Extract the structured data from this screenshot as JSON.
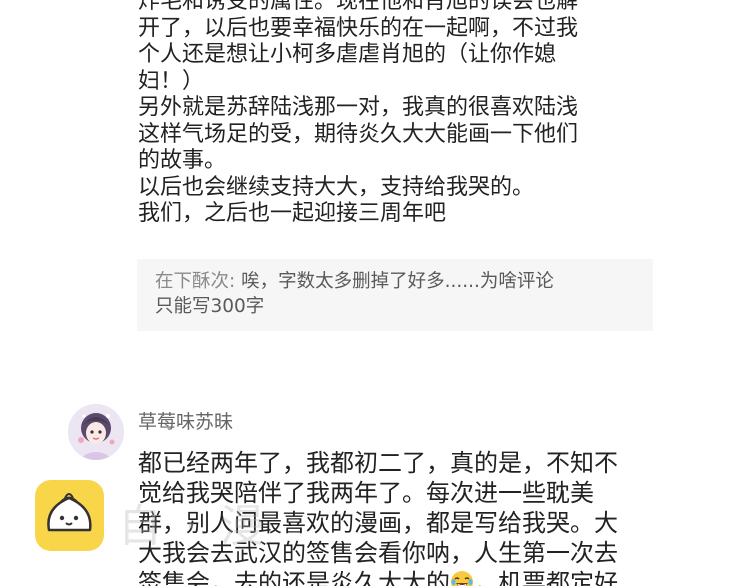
{
  "first_comment": {
    "lines": [
      "炸毛和诱受的属性。现在他和肖旭的误会也解",
      "开了，以后也要幸福快乐的在一起啊，不过我",
      "个人还是想让小柯多虐虐肖旭的（让你作媳",
      "妇！）",
      "另外就是苏辞陆浅那一对，我真的很喜欢陆浅",
      "这样气场足的受，期待炎久大大能画一下他们",
      "的故事。",
      "以后也会继续支持大大，支持给我哭的。",
      "我们，之后也一起迎接三周年吧"
    ]
  },
  "reply": {
    "author": "在下酥次:",
    "line1": " 唉，字数太多删掉了好多......为啥评论",
    "line2": "只能写300字"
  },
  "second_comment": {
    "username": "草莓味苏昧",
    "lines": [
      "都已经两年了，我都初二了，真的是，不知不",
      "觉给我哭陪伴了我两年了。每次进一些耽美",
      "群，别人问最喜欢的漫画，都是写给我哭。大",
      "大我会去武汉的签售会看你呐，人生第一次去"
    ],
    "last_line_before_emoji": "签售会，去的还是炎久大大的",
    "emoji": "laughing-tears-emoji",
    "last_line_after_emoji": "，机票都定好"
  },
  "watermark": {
    "text": "自 · 漫"
  },
  "colors": {
    "reply_bg": "#f6f6f6",
    "logo_yellow": "#f9d54a"
  }
}
